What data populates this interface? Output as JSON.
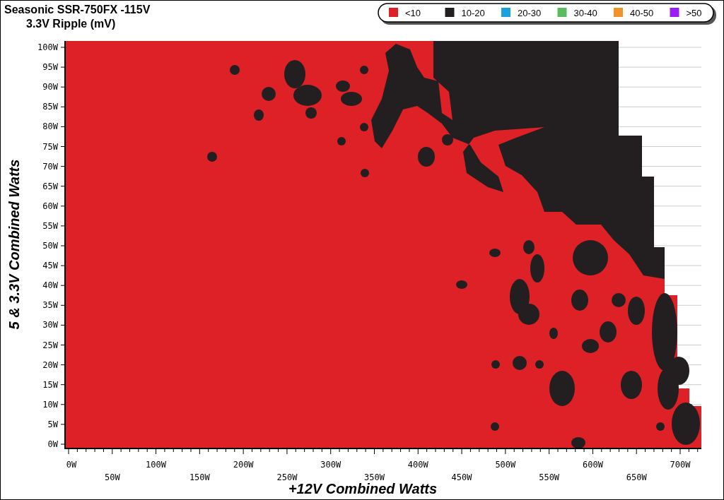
{
  "title": "Seasonic SSR-750FX -115V",
  "subtitle": "3.3V Ripple (mV)",
  "legend": [
    {
      "label": "<10",
      "color": "#dd2127"
    },
    {
      "label": "10-20",
      "color": "#231f20"
    },
    {
      "label": "20-30",
      "color": "#1ba1dd"
    },
    {
      "label": "30-40",
      "color": "#5cbb5c"
    },
    {
      "label": "40-50",
      "color": "#f0932b"
    },
    {
      "label": ">50",
      "color": "#9b1cf5"
    }
  ],
  "y_axis": {
    "title": "5 & 3.3V Combined Watts",
    "ticks": [
      "100W",
      "95W",
      "90W",
      "85W",
      "80W",
      "75W",
      "70W",
      "65W",
      "60W",
      "55W",
      "50W",
      "45W",
      "40W",
      "35W",
      "30W",
      "25W",
      "20W",
      "15W",
      "10W",
      "5W",
      "0W"
    ]
  },
  "x_axis": {
    "title": "+12V Combined Watts",
    "ticks": [
      "0W",
      "50W",
      "100W",
      "150W",
      "200W",
      "250W",
      "300W",
      "350W",
      "400W",
      "450W",
      "500W",
      "550W",
      "600W",
      "650W",
      "700W"
    ]
  }
}
